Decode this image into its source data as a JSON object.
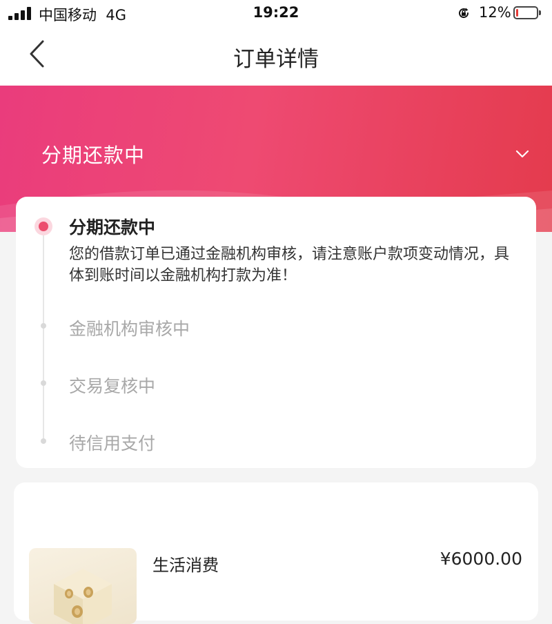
{
  "status_bar": {
    "carrier": "中国移动",
    "network": "4G",
    "time": "19:22",
    "battery_percent": "12%",
    "battery_level": 0.12,
    "icons": [
      "signal-icon",
      "rotation-lock-icon",
      "battery-icon"
    ]
  },
  "nav": {
    "title": "订单详情",
    "back_icon": "chevron-left-icon"
  },
  "header": {
    "status_title": "分期还款中",
    "toggle_icon": "chevron-down-icon"
  },
  "progress": {
    "steps": [
      {
        "title": "分期还款中",
        "description": "您的借款订单已通过金融机构审核，请注意账户款项变动情况，具体到账时间以金融机构打款为准！",
        "active": true
      },
      {
        "title": "金融机构审核中",
        "active": false
      },
      {
        "title": "交易复核中",
        "active": false
      },
      {
        "title": "待信用支付",
        "active": false
      }
    ]
  },
  "product": {
    "name": "生活消费",
    "price": "¥6000.00"
  },
  "colors": {
    "accent": "#ec4e6e",
    "header_gradient_start": "#ea3c7c",
    "header_gradient_end": "#e43b4d",
    "battery_low": "#e53935"
  }
}
